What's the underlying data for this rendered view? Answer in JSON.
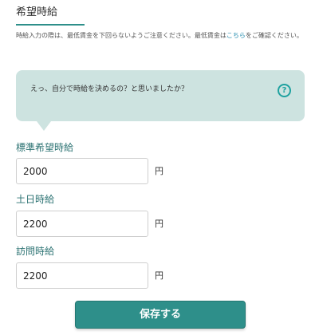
{
  "section": {
    "title": "希望時給"
  },
  "notice": {
    "text_before_link": "時給入力の際は、最低賃金を下回らないようご注意ください。最低賃金は",
    "link_text": "こちら",
    "text_after_link": "をご確認ください。"
  },
  "callout": {
    "text": "えっ、自分で時給を決めるの？と思いましたか？",
    "help_icon": "question-circle-icon"
  },
  "fields": [
    {
      "label": "標準希望時給",
      "value": "2000",
      "unit": "円"
    },
    {
      "label": "土日時給",
      "value": "2200",
      "unit": "円"
    },
    {
      "label": "訪問時給",
      "value": "2200",
      "unit": "円"
    }
  ],
  "actions": {
    "save_label": "保存する"
  },
  "colors": {
    "accent": "#2e8f8a",
    "callout_background": "#cde3e0",
    "link": "#2a8fb0",
    "label": "#2b7272"
  }
}
